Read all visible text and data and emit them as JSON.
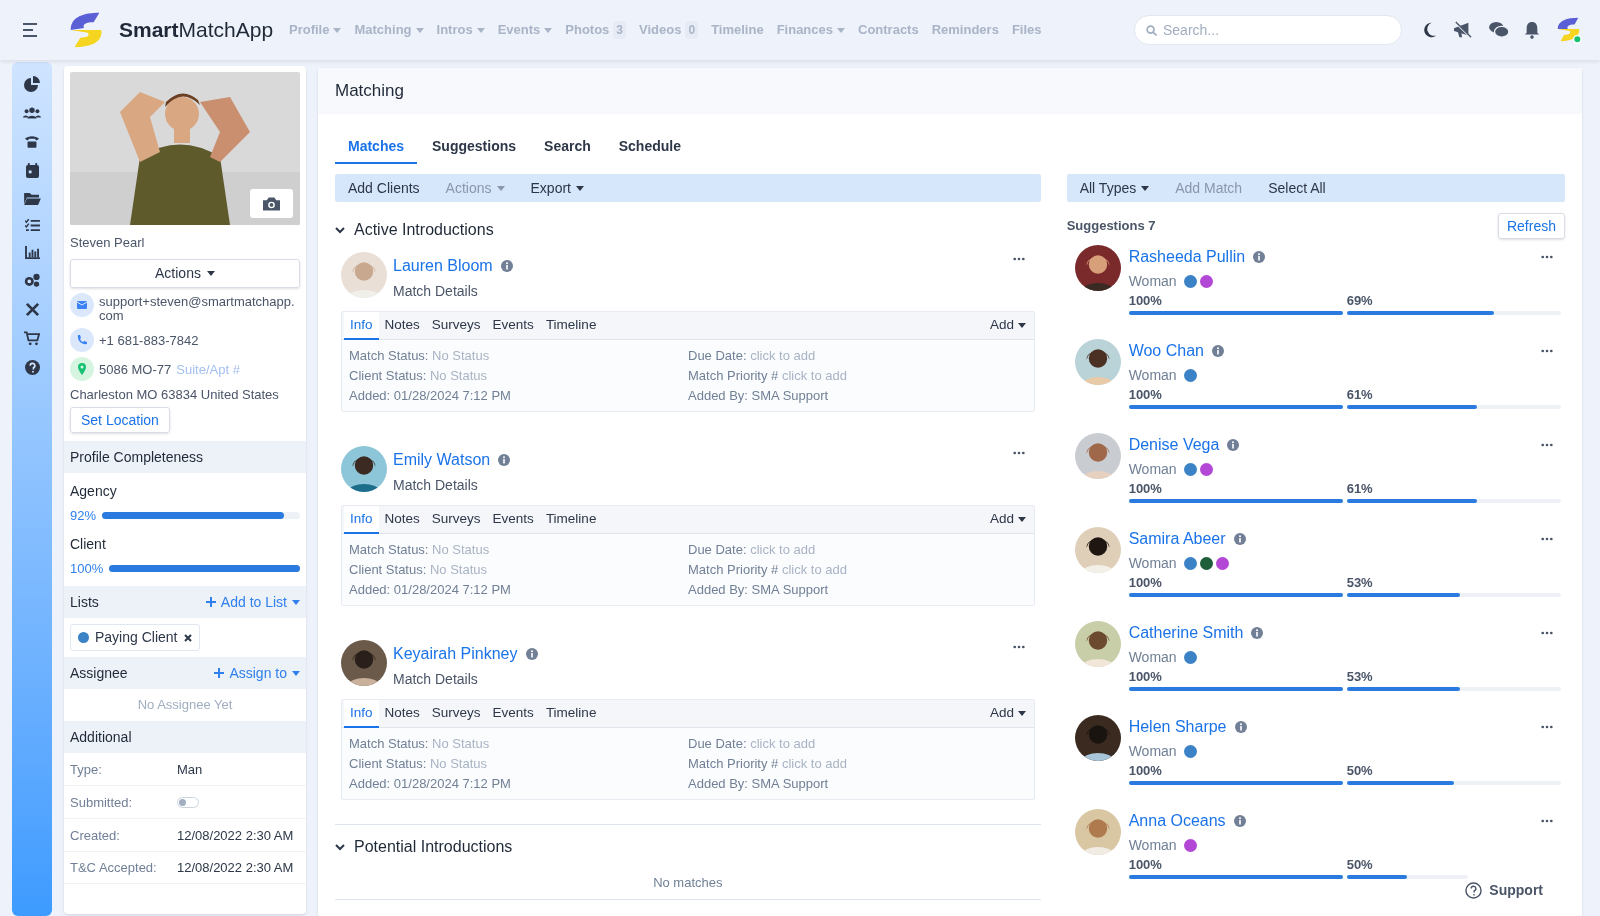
{
  "app": {
    "name_bold": "Smart",
    "name_rest": "MatchApp"
  },
  "nav": [
    {
      "label": "Profile",
      "dropdown": true
    },
    {
      "label": "Matching",
      "dropdown": true
    },
    {
      "label": "Intros",
      "dropdown": true
    },
    {
      "label": "Events",
      "dropdown": true
    },
    {
      "label": "Photos",
      "count": "3"
    },
    {
      "label": "Videos",
      "count": "0"
    },
    {
      "label": "Timeline"
    },
    {
      "label": "Finances",
      "dropdown": true
    },
    {
      "label": "Contracts"
    },
    {
      "label": "Reminders"
    },
    {
      "label": "Files"
    }
  ],
  "search": {
    "placeholder": "Search..."
  },
  "profile": {
    "name": "Steven Pearl",
    "actions": "Actions",
    "email": "support+steven@smartmatchapp.com",
    "phone": "+1 681-883-7842",
    "street": "5086 MO-77",
    "suite_placeholder": "Suite/Apt #",
    "city": "Charleston MO 63834 United States",
    "set_location": "Set Location",
    "completeness": {
      "title": "Profile Completeness",
      "bars": [
        {
          "label": "Agency",
          "reading": "92%",
          "level": 0.92
        },
        {
          "label": "Client",
          "reading": "100%",
          "level": 1
        }
      ]
    },
    "lists": {
      "title": "Lists",
      "add": "Add to List",
      "tags": [
        {
          "label": "Paying Client",
          "color": "#3b82c6"
        }
      ]
    },
    "assignee": {
      "title": "Assignee",
      "add": "Assign to",
      "empty": "No Assignee Yet"
    },
    "additional": {
      "title": "Additional",
      "rows": [
        {
          "kind": "text",
          "label": "Type:",
          "value": "Man"
        },
        {
          "kind": "toggle",
          "label": "Submitted:",
          "on": false
        },
        {
          "kind": "text",
          "label": "Created:",
          "value": "12/08/2022 2:30 AM"
        },
        {
          "kind": "text",
          "label": "T&C Accepted:",
          "value": "12/08/2022 2:30 AM"
        }
      ]
    }
  },
  "main": {
    "title": "Matching",
    "tabs": [
      {
        "label": "Matches",
        "selected": true
      },
      {
        "label": "Suggestions",
        "selected": false
      },
      {
        "label": "Search",
        "selected": false
      },
      {
        "label": "Schedule",
        "selected": false
      }
    ],
    "toolbar": [
      {
        "label": "Add Clients",
        "dropdown": false,
        "disabled": false
      },
      {
        "label": "Actions",
        "dropdown": true,
        "disabled": true
      },
      {
        "label": "Export",
        "dropdown": true,
        "disabled": false
      }
    ],
    "active": {
      "title": "Active Introductions",
      "expanded": true,
      "items": [
        {
          "name": "Lauren Bloom",
          "sub": "Match Details",
          "tabs": [
            {
              "label": "Info",
              "selected": true
            },
            {
              "label": "Notes",
              "selected": false
            },
            {
              "label": "Surveys",
              "selected": false
            },
            {
              "label": "Events",
              "selected": false
            },
            {
              "label": "Timeline",
              "selected": false
            }
          ],
          "add": "Add",
          "left": [
            {
              "label": "Match Status:",
              "placeholder": "No Status"
            },
            {
              "label": "Client Status:",
              "placeholder": "No Status"
            },
            {
              "label": "Added:",
              "value": "01/28/2024 7:12 PM"
            }
          ],
          "right": [
            {
              "label": "Due Date:",
              "placeholder": "click to add"
            },
            {
              "label": "Match Priority #",
              "placeholder": "click to add"
            },
            {
              "label": "Added By:",
              "value": "SMA Support"
            }
          ]
        },
        {
          "name": "Emily Watson",
          "sub": "Match Details",
          "tabs": [
            {
              "label": "Info",
              "selected": true
            },
            {
              "label": "Notes",
              "selected": false
            },
            {
              "label": "Surveys",
              "selected": false
            },
            {
              "label": "Events",
              "selected": false
            },
            {
              "label": "Timeline",
              "selected": false
            }
          ],
          "add": "Add",
          "left": [
            {
              "label": "Match Status:",
              "placeholder": "No Status"
            },
            {
              "label": "Client Status:",
              "placeholder": "No Status"
            },
            {
              "label": "Added:",
              "value": "01/28/2024 7:12 PM"
            }
          ],
          "right": [
            {
              "label": "Due Date:",
              "placeholder": "click to add"
            },
            {
              "label": "Match Priority #",
              "placeholder": "click to add"
            },
            {
              "label": "Added By:",
              "value": "SMA Support"
            }
          ]
        },
        {
          "name": "Keyairah Pinkney",
          "sub": "Match Details",
          "tabs": [
            {
              "label": "Info",
              "selected": true
            },
            {
              "label": "Notes",
              "selected": false
            },
            {
              "label": "Surveys",
              "selected": false
            },
            {
              "label": "Events",
              "selected": false
            },
            {
              "label": "Timeline",
              "selected": false
            }
          ],
          "add": "Add",
          "left": [
            {
              "label": "Match Status:",
              "placeholder": "No Status"
            },
            {
              "label": "Client Status:",
              "placeholder": "No Status"
            },
            {
              "label": "Added:",
              "value": "01/28/2024 7:12 PM"
            }
          ],
          "right": [
            {
              "label": "Due Date:",
              "placeholder": "click to add"
            },
            {
              "label": "Match Priority #",
              "placeholder": "click to add"
            },
            {
              "label": "Added By:",
              "value": "SMA Support"
            }
          ]
        }
      ]
    },
    "potential": {
      "title": "Potential Introductions",
      "expanded": true,
      "empty": "No matches"
    }
  },
  "suggestions": {
    "toolbar": [
      {
        "label": "All Types",
        "dropdown": true,
        "disabled": false
      },
      {
        "label": "Add Match",
        "dropdown": false,
        "disabled": true
      },
      {
        "label": "Select All",
        "dropdown": false,
        "disabled": false
      }
    ],
    "title": "Suggestions 7",
    "refresh": "Refresh",
    "items": [
      {
        "name": "Rasheeda Pullin",
        "gender": "Woman",
        "dots": [
          {
            "color": "#3b82c6"
          },
          {
            "color": "#b347d6"
          }
        ],
        "bars": [
          {
            "reading": "100%",
            "level": 1
          },
          {
            "reading": "69%",
            "level": 0.69
          }
        ]
      },
      {
        "name": "Woo Chan",
        "gender": "Woman",
        "dots": [
          {
            "color": "#3b82c6"
          }
        ],
        "bars": [
          {
            "reading": "100%",
            "level": 1
          },
          {
            "reading": "61%",
            "level": 0.61
          }
        ]
      },
      {
        "name": "Denise Vega",
        "gender": "Woman",
        "dots": [
          {
            "color": "#3b82c6"
          },
          {
            "color": "#b347d6"
          }
        ],
        "bars": [
          {
            "reading": "100%",
            "level": 1
          },
          {
            "reading": "61%",
            "level": 0.61
          }
        ]
      },
      {
        "name": "Samira Abeer",
        "gender": "Woman",
        "dots": [
          {
            "color": "#3b82c6"
          },
          {
            "color": "#1f5e3a"
          },
          {
            "color": "#b347d6"
          }
        ],
        "bars": [
          {
            "reading": "100%",
            "level": 1
          },
          {
            "reading": "53%",
            "level": 0.53
          }
        ]
      },
      {
        "name": "Catherine Smith",
        "gender": "Woman",
        "dots": [
          {
            "color": "#3b82c6"
          }
        ],
        "bars": [
          {
            "reading": "100%",
            "level": 1
          },
          {
            "reading": "53%",
            "level": 0.53
          }
        ]
      },
      {
        "name": "Helen Sharpe",
        "gender": "Woman",
        "dots": [
          {
            "color": "#3b82c6"
          }
        ],
        "bars": [
          {
            "reading": "100%",
            "level": 1
          },
          {
            "reading": "50%",
            "level": 0.5
          }
        ]
      },
      {
        "name": "Anna Oceans",
        "gender": "Woman",
        "dots": [
          {
            "color": "#b347d6"
          }
        ],
        "bars": [
          {
            "reading": "100%",
            "level": 1
          },
          {
            "reading": "50%",
            "level": 0.5
          }
        ]
      }
    ]
  },
  "support": "Support"
}
